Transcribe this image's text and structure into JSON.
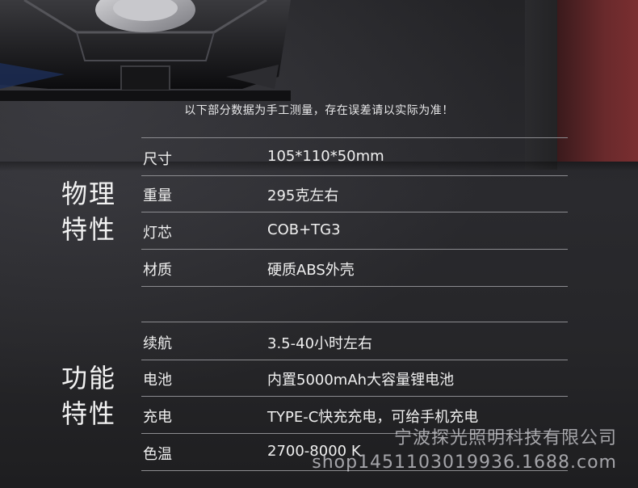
{
  "notice": "以下部分数据为手工测量，存在误差请以实际为准！",
  "groups": [
    {
      "title_line1": "物理",
      "title_line2": "特性",
      "rows": [
        {
          "label": "尺寸",
          "value": "105*110*50mm"
        },
        {
          "label": "重量",
          "value": "295克左右"
        },
        {
          "label": "灯芯",
          "value": "COB+TG3"
        },
        {
          "label": "材质",
          "value": "硬质ABS外壳"
        }
      ]
    },
    {
      "title_line1": "功能",
      "title_line2": "特性",
      "rows": [
        {
          "label": "续航",
          "value": "3.5-40小时左右"
        },
        {
          "label": "电池",
          "value": "内置5000mAh大容量锂电池"
        },
        {
          "label": "充电",
          "value": "TYPE-C快充充电，可给手机充电"
        },
        {
          "label": "色温",
          "value": "2700-8000 K"
        }
      ]
    }
  ],
  "watermark": {
    "company": "宁波探光照明科技有限公司",
    "shop": "shop1451103019936.1688.com"
  },
  "colors": {
    "text": "#f0f0f0",
    "divider": "#8c8c90",
    "accent_wall": "#7a2e30"
  }
}
